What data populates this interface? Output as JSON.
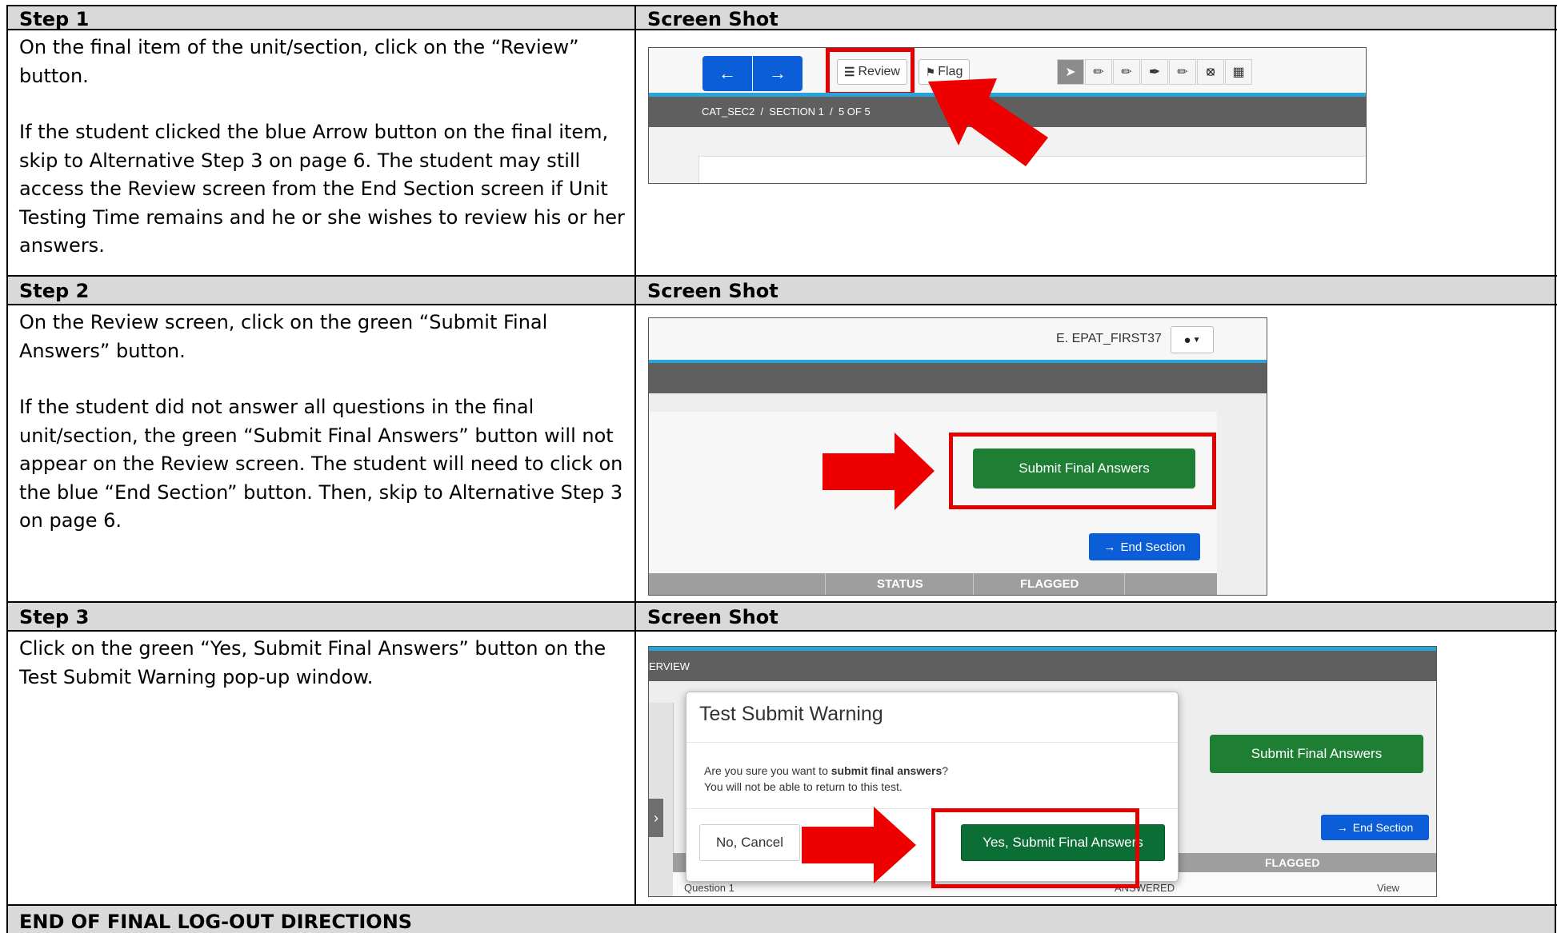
{
  "steps": [
    {
      "header": "Step 1",
      "shot_header": "Screen Shot",
      "paragraphs": [
        "On the final item of the unit/section, click on the “Review” button.",
        "If the student clicked the blue Arrow button on the final item, skip to Alternative Step 3 on page 6. The student may still access the Review screen from the End Section screen if Unit Testing Time remains and he or she wishes to review his or her answers."
      ]
    },
    {
      "header": "Step 2",
      "shot_header": "Screen Shot",
      "paragraphs": [
        "On the Review screen, click on the green “Submit Final Answers” button.",
        "If the student did not answer all questions in the final unit/section, the green “Submit Final Answers” button will not appear on the Review screen. The student will need to click on the blue “End Section” button. Then, skip to Alternative Step 3 on page 6."
      ]
    },
    {
      "header": "Step 3",
      "shot_header": "Screen Shot",
      "paragraphs": [
        "Click on the green “Yes, Submit Final Answers” button on the Test Submit Warning pop-up window."
      ]
    }
  ],
  "footer": "END OF FINAL LOG-OUT DIRECTIONS",
  "shot1": {
    "review_label": "Review",
    "flag_label": "Flag",
    "breadcrumb": "CAT_SEC2  /  SECTION 1  /  5 OF 5"
  },
  "shot2": {
    "user_name": "E. EPAT_FIRST37",
    "submit_label": "Submit Final Answers",
    "end_section_label": "End Section",
    "col_status": "STATUS",
    "col_flagged": "FLAGGED"
  },
  "shot3": {
    "header_fragment": "ERVIEW",
    "modal_title": "Test Submit Warning",
    "modal_line1_pre": "Are you sure you want to ",
    "modal_line1_bold": "submit final answers",
    "modal_line1_post": "?",
    "modal_line2": "You will not be able to return to this test.",
    "no_label": "No, Cancel",
    "yes_label": "Yes, Submit Final Answers",
    "bg_submit_label": "Submit Final Answers",
    "bg_end_section_label": "End Section",
    "bg_flagged": "FLAGGED",
    "bg_question": "Question 1",
    "bg_answered": "ANSWERED",
    "bg_view": "View"
  },
  "colors": {
    "header_bg": "#d9d9d9",
    "blue_button": "#0b5ed7",
    "green_button": "#1e7e34",
    "highlight_red": "#e30000",
    "accent_bar": "#29a3d8",
    "dark_bar": "#5f5f5f"
  }
}
